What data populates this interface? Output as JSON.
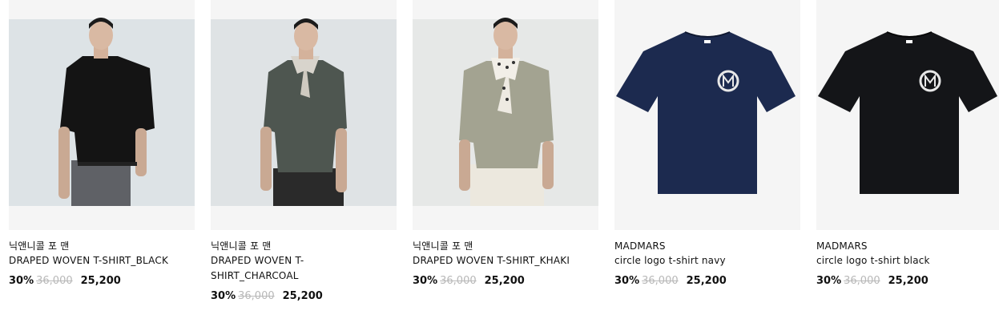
{
  "products": [
    {
      "brand": "닉앤니콜 포 맨",
      "name": "DRAPED WOVEN T-SHIRT_BLACK",
      "discount": "30%",
      "original_price": "36,000",
      "sale_price": "25,200",
      "shirt_color": "#141414",
      "bg": "#dde3e6",
      "image": "model-photo"
    },
    {
      "brand": "닉앤니콜 포 맨",
      "name": "DRAPED WOVEN T-SHIRT_CHARCOAL",
      "discount": "30%",
      "original_price": "36,000",
      "sale_price": "25,200",
      "shirt_color": "#4e5650",
      "bg": "#dfe3e5",
      "image": "model-photo"
    },
    {
      "brand": "닉앤니콜 포 맨",
      "name": "DRAPED WOVEN T-SHIRT_KHAKI",
      "discount": "30%",
      "original_price": "36,000",
      "sale_price": "25,200",
      "shirt_color": "#a3a391",
      "bg": "#e6e8e7",
      "image": "model-photo"
    },
    {
      "brand": "MADMARS",
      "name": "circle logo t-shirt navy",
      "discount": "30%",
      "original_price": "36,000",
      "sale_price": "25,200",
      "shirt_color": "#1c2a4f",
      "bg": "#f5f5f5",
      "image": "product-flat"
    },
    {
      "brand": "MADMARS",
      "name": "circle logo t-shirt black",
      "discount": "30%",
      "original_price": "36,000",
      "sale_price": "25,200",
      "shirt_color": "#141518",
      "bg": "#f5f5f5",
      "image": "product-flat"
    }
  ]
}
